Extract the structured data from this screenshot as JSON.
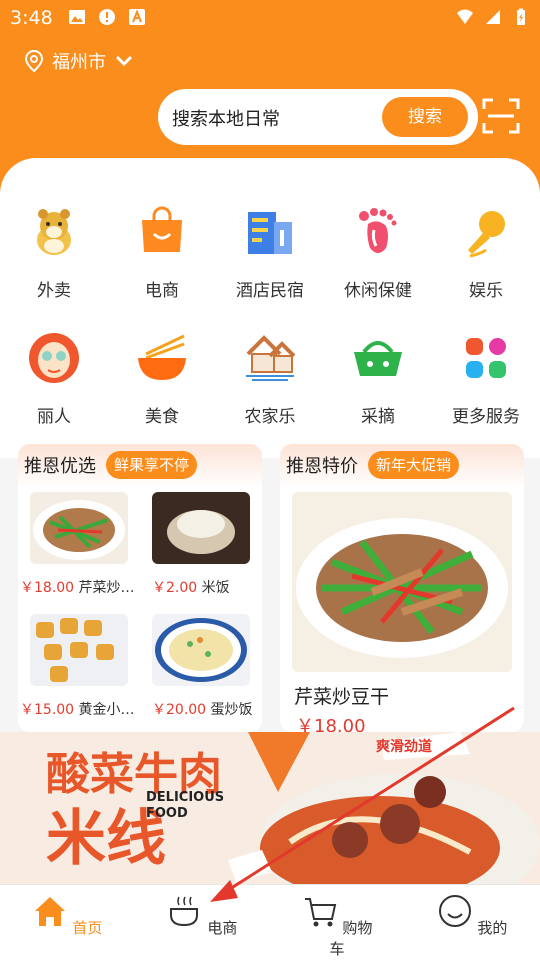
{
  "status_bar": {
    "time": "3:48"
  },
  "location": {
    "city": "福州市"
  },
  "search": {
    "placeholder": "搜索本地日常",
    "button_label": "搜索"
  },
  "categories": [
    {
      "label": "外卖",
      "icon": "hamster-icon"
    },
    {
      "label": "电商",
      "icon": "shopping-bag-icon"
    },
    {
      "label": "酒店民宿",
      "icon": "hotel-icon"
    },
    {
      "label": "休闲保健",
      "icon": "footprint-icon"
    },
    {
      "label": "娱乐",
      "icon": "microphone-icon"
    },
    {
      "label": "丽人",
      "icon": "beauty-face-icon"
    },
    {
      "label": "美食",
      "icon": "bowl-chopsticks-icon"
    },
    {
      "label": "农家乐",
      "icon": "farmhouse-icon"
    },
    {
      "label": "采摘",
      "icon": "basket-icon"
    },
    {
      "label": "更多服务",
      "icon": "more-grid-icon"
    }
  ],
  "promo_left": {
    "title": "推恩优选",
    "tag": "鲜果享不停",
    "items": [
      {
        "price": "￥18.00",
        "name": "芹菜炒…"
      },
      {
        "price": "￥2.00",
        "name": "米饭"
      },
      {
        "price": "￥15.00",
        "name": "黄金小…"
      },
      {
        "price": "￥20.00",
        "name": "蛋炒饭"
      }
    ]
  },
  "promo_right": {
    "title": "推恩特价",
    "tag": "新年大促销",
    "item": {
      "name": "芹菜炒豆干",
      "price": "￥18.00"
    }
  },
  "banner": {
    "title_line1": "酸菜牛肉",
    "title_line2": "米线",
    "english": "DELICIOUS FOOD",
    "slogan": "爽滑劲道"
  },
  "tabbar": [
    {
      "label": "首页",
      "icon": "home-icon",
      "active": true
    },
    {
      "label": "电商",
      "icon": "cup-icon",
      "active": false
    },
    {
      "label": "购物车",
      "icon": "cart-icon",
      "active": false
    },
    {
      "label": "我的",
      "icon": "smiley-icon",
      "active": false
    }
  ],
  "colors": {
    "brand": "#fb8d1c",
    "price": "#e33b2f",
    "active_tab": "#fb8d1c"
  }
}
